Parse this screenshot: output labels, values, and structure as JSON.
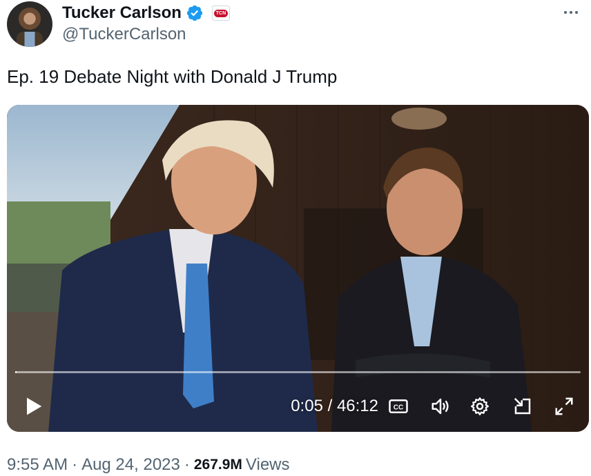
{
  "author": {
    "display_name": "Tucker Carlson",
    "handle": "@TuckerCarlson",
    "affiliate_badge_text": "TCN",
    "verified_color": "#1d9bf0"
  },
  "tweet": {
    "text": "Ep. 19  Debate Night with Donald J Trump"
  },
  "video": {
    "current_time": "0:05",
    "time_separator": "/",
    "duration": "46:12",
    "progress_fraction": 0.002,
    "cc_label": "CC"
  },
  "meta": {
    "time": "9:55 AM",
    "separator": "·",
    "date": "Aug 24, 2023",
    "views_count": "267.9M",
    "views_label": "Views"
  },
  "colors": {
    "text_primary": "#0f1419",
    "text_secondary": "#536471",
    "badge_red": "#c8102e"
  },
  "icons": [
    "more-icon",
    "verified-icon",
    "play-icon",
    "cc-icon",
    "volume-icon",
    "gear-icon",
    "dock-icon",
    "fullscreen-icon"
  ]
}
